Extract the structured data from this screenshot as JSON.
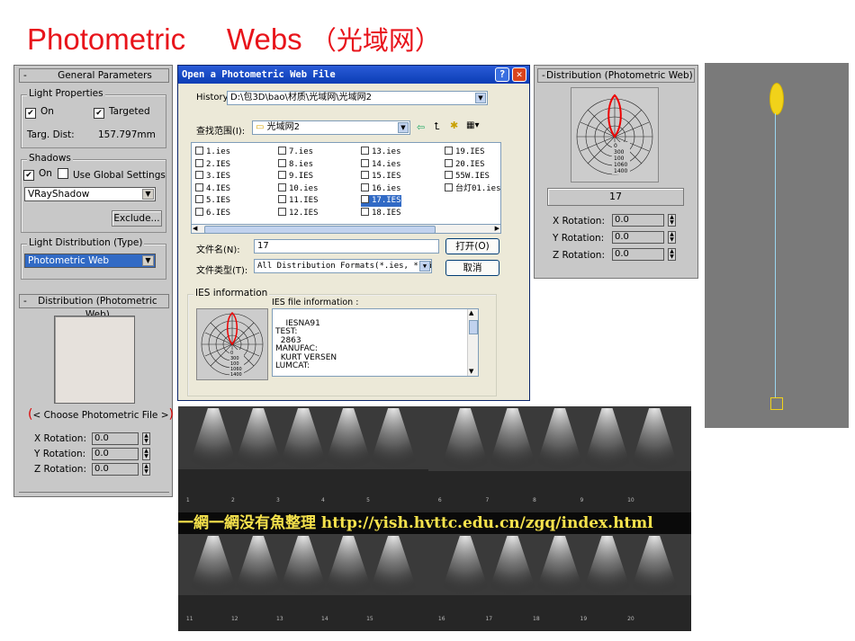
{
  "title": {
    "part1": "Photometric",
    "part2": "Webs",
    "part3": "（光域网）"
  },
  "left_panel": {
    "general": {
      "header": "General Parameters",
      "collapse": "-"
    },
    "light_props": {
      "label": "Light Properties",
      "on_label": "On",
      "targeted_label": "Targeted",
      "targ_dist_label": "Targ. Dist:",
      "targ_dist_value": "157.797mm"
    },
    "shadows": {
      "label": "Shadows",
      "on_label": "On",
      "use_global_label": "Use Global Settings",
      "type": "VRayShadow",
      "exclude_label": "Exclude..."
    },
    "light_dist": {
      "label": "Light Distribution (Type)",
      "value": "Photometric Web"
    },
    "distribution": {
      "header": "Distribution (Photometric Web)",
      "choose_button": "< Choose Photometric File >",
      "x_label": "X Rotation:",
      "x_value": "0.0",
      "y_label": "Y Rotation:",
      "y_value": "0.0",
      "z_label": "Z Rotation:",
      "z_value": "0.0"
    }
  },
  "dialog": {
    "title": "Open a Photometric Web File",
    "help_button": "?",
    "close_button": "✕",
    "history_label": "History:",
    "history_value": "D:\\包3D\\bao\\材质\\光域网\\光域网2",
    "lookin_label": "查找范围(I):",
    "lookin_value": "光域网2",
    "files": [
      "1.ies",
      "2.IES",
      "3.IES",
      "4.IES",
      "5.IES",
      "6.IES",
      "7.ies",
      "8.ies",
      "9.IES",
      "10.ies",
      "11.IES",
      "12.IES",
      "13.ies",
      "14.ies",
      "15.IES",
      "16.ies",
      "17.IES",
      "18.IES",
      "19.IES",
      "20.IES",
      "55W.IES",
      "台灯01.ies"
    ],
    "selected_file": "17.IES",
    "filename_label": "文件名(N):",
    "filename_value": "17",
    "filetype_label": "文件类型(T):",
    "filetype_value": "All Distribution Formats(*.ies, *.ci",
    "open_button": "打开(O)",
    "cancel_button": "取消",
    "ies_info_label": "IES information",
    "ies_file_info_label": "IES file information :",
    "ies_text": "IESNA91\nTEST:\n  2863\nMANUFAC:\n  KURT VERSEN\nLUMCAT:",
    "chart_values": [
      "0",
      "300",
      "100",
      "1060",
      "1400"
    ]
  },
  "right_panel": {
    "header": "Distribution (Photometric Web)",
    "file_value": "17",
    "x_label": "X Rotation:",
    "x_value": "0.0",
    "y_label": "Y Rotation:",
    "y_value": "0.0",
    "z_label": "Z Rotation:",
    "z_value": "0.0",
    "chart_values": [
      "0",
      "300",
      "100",
      "1060",
      "1400"
    ]
  },
  "renders": {
    "panel1_numbers": [
      "1",
      "2",
      "3",
      "4",
      "5"
    ],
    "panel2_numbers": [
      "6",
      "7",
      "8",
      "9",
      "10"
    ],
    "panel3_numbers": [
      "11",
      "12",
      "13",
      "14",
      "15"
    ],
    "panel4_numbers": [
      "16",
      "17",
      "18",
      "19",
      "20"
    ],
    "caption": "一網一網没有魚整理 http://yish.hvttc.edu.cn/zgq/index.html"
  }
}
